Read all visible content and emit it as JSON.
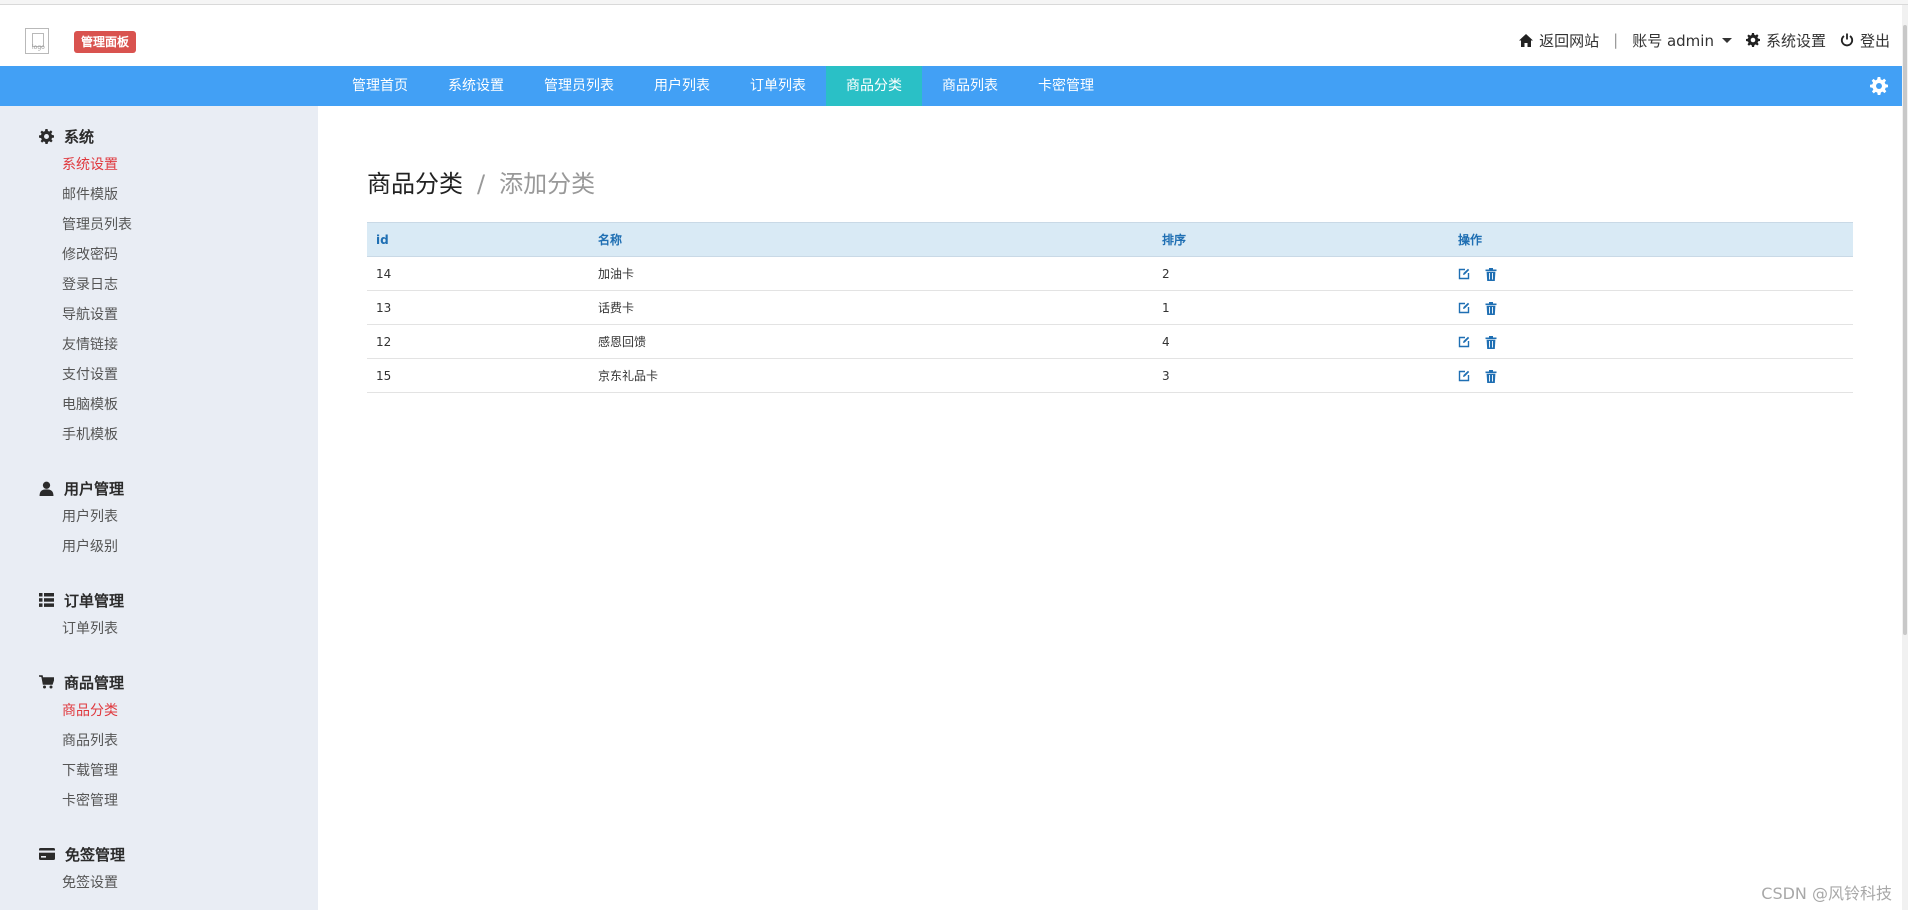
{
  "header": {
    "logo_alt": "logo",
    "brand_badge": "管理面板",
    "back_site": "返回网站",
    "separator": "|",
    "account": "账号 admin",
    "settings": "系统设置",
    "logout": "登出"
  },
  "nav": {
    "items": [
      {
        "label": "管理首页",
        "active": false
      },
      {
        "label": "系统设置",
        "active": false
      },
      {
        "label": "管理员列表",
        "active": false
      },
      {
        "label": "用户列表",
        "active": false
      },
      {
        "label": "订单列表",
        "active": false
      },
      {
        "label": "商品分类",
        "active": true
      },
      {
        "label": "商品列表",
        "active": false
      },
      {
        "label": "卡密管理",
        "active": false
      }
    ],
    "settings_icon": "gear-icon"
  },
  "sidebar": {
    "groups": [
      {
        "title": "系统",
        "icon": "gear-icon",
        "items": [
          "系统设置",
          "邮件模版",
          "管理员列表",
          "修改密码",
          "登录日志",
          "导航设置",
          "友情链接",
          "支付设置",
          "电脑模板",
          "手机模板"
        ]
      },
      {
        "title": "用户管理",
        "icon": "user-icon",
        "items": [
          "用户列表",
          "用户级别"
        ]
      },
      {
        "title": "订单管理",
        "icon": "list-icon",
        "items": [
          "订单列表"
        ]
      },
      {
        "title": "商品管理",
        "icon": "cart-icon",
        "items": [
          "商品分类",
          "商品列表",
          "下载管理",
          "卡密管理"
        ]
      },
      {
        "title": "免签管理",
        "icon": "card-icon",
        "items": [
          "免签设置"
        ]
      }
    ]
  },
  "main": {
    "title": "商品分类",
    "slash": "/",
    "add_link": "添加分类",
    "table": {
      "headers": [
        "id",
        "名称",
        "排序",
        "操作"
      ],
      "rows": [
        [
          "14",
          "加油卡",
          "2"
        ],
        [
          "13",
          "话费卡",
          "1"
        ],
        [
          "12",
          "感恩回馈",
          "4"
        ],
        [
          "15",
          "京东礼品卡",
          "3"
        ]
      ]
    }
  },
  "watermark": "CSDN @风铃科技",
  "colors": {
    "nav_bg": "#42a0f5",
    "nav_active": "#2ac0c6",
    "sidebar_bg": "#e9edf4",
    "active_link": "#e0393e",
    "badge": "#d9534f",
    "table_head_bg": "#d9eaf5",
    "table_head_text": "#1f6fb3"
  }
}
